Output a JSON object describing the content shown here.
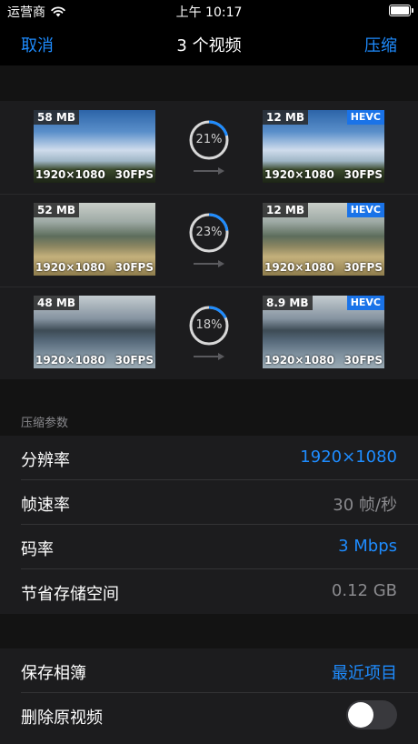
{
  "status": {
    "carrier": "运营商",
    "time": "上午 10:17"
  },
  "nav": {
    "cancel": "取消",
    "title": "3 个视频",
    "compress": "压缩"
  },
  "videos": [
    {
      "src_size": "58 MB",
      "dst_size": "12 MB",
      "resolution": "1920×1080",
      "fps": "30FPS",
      "progress_label": "21%",
      "progress": 0.21,
      "badge": "HEVC",
      "scene": "sky"
    },
    {
      "src_size": "52 MB",
      "dst_size": "12 MB",
      "resolution": "1920×1080",
      "fps": "30FPS",
      "progress_label": "23%",
      "progress": 0.23,
      "badge": "HEVC",
      "scene": "valley"
    },
    {
      "src_size": "48 MB",
      "dst_size": "8.9 MB",
      "resolution": "1920×1080",
      "fps": "30FPS",
      "progress_label": "18%",
      "progress": 0.18,
      "badge": "HEVC",
      "scene": "lake"
    }
  ],
  "params": {
    "header": "压缩参数",
    "rows": [
      {
        "label": "分辨率",
        "value": "1920×1080"
      },
      {
        "label": "帧速率",
        "value": "30 帧/秒"
      },
      {
        "label": "码率",
        "value": "3 Mbps"
      },
      {
        "label": "节省存储空间",
        "value": "0.12 GB"
      }
    ]
  },
  "save": {
    "album_label": "保存相簿",
    "album_value": "最近项目",
    "delete_label": "删除原视频",
    "delete_enabled": false
  },
  "colors": {
    "accent": "#1e8cff",
    "badge": "#1a73e8",
    "background": "#000000",
    "cell": "#1c1c1e"
  }
}
